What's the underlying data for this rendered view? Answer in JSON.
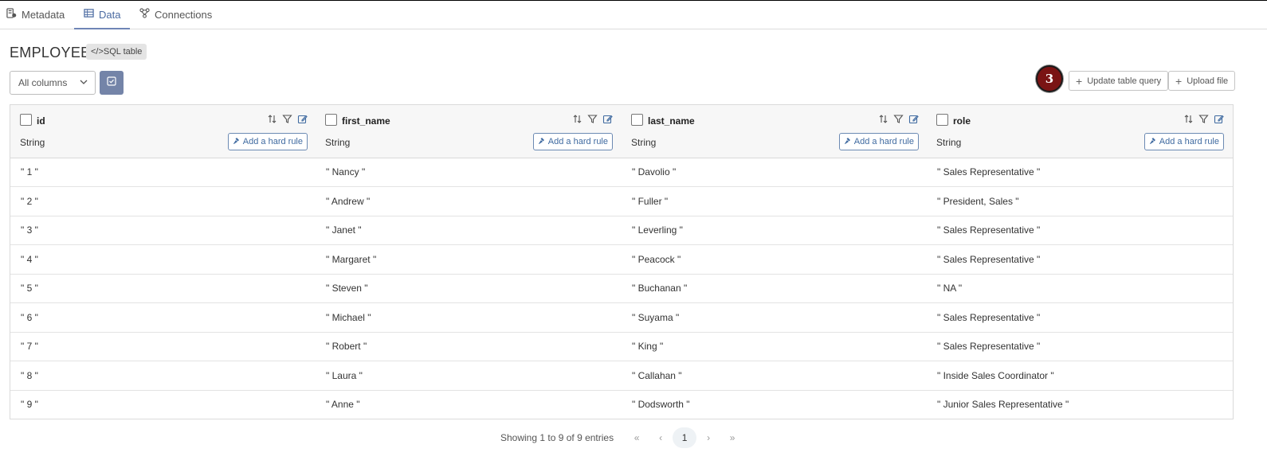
{
  "tabs": [
    {
      "label": "Metadata",
      "icon": "metadata-icon"
    },
    {
      "label": "Data",
      "icon": "table-icon"
    },
    {
      "label": "Connections",
      "icon": "connections-icon"
    }
  ],
  "page": {
    "title": "EMPLOYEE",
    "badge": "</>SQL table"
  },
  "controls": {
    "column_select": "All columns"
  },
  "marker": {
    "label": "3"
  },
  "actions": {
    "update_query": "Update table query",
    "upload_file": "Upload file"
  },
  "table": {
    "columns": [
      {
        "name": "id",
        "type": "String",
        "rule_label": "Add a hard rule"
      },
      {
        "name": "first_name",
        "type": "String",
        "rule_label": "Add a hard rule"
      },
      {
        "name": "last_name",
        "type": "String",
        "rule_label": "Add a hard rule"
      },
      {
        "name": "role",
        "type": "String",
        "rule_label": "Add a hard rule"
      }
    ],
    "rows": [
      [
        "\" 1 \"",
        "\" Nancy \"",
        "\" Davolio \"",
        "\" Sales Representative \""
      ],
      [
        "\" 2 \"",
        "\" Andrew \"",
        "\" Fuller \"",
        "\" President, Sales \""
      ],
      [
        "\" 3 \"",
        "\" Janet \"",
        "\" Leverling \"",
        "\" Sales Representative \""
      ],
      [
        "\" 4 \"",
        "\" Margaret \"",
        "\" Peacock \"",
        "\" Sales Representative \""
      ],
      [
        "\" 5 \"",
        "\" Steven \"",
        "\" Buchanan \"",
        "\" NA \""
      ],
      [
        "\" 6 \"",
        "\" Michael \"",
        "\" Suyama \"",
        "\" Sales Representative \""
      ],
      [
        "\" 7 \"",
        "\" Robert \"",
        "\" King \"",
        "\" Sales Representative \""
      ],
      [
        "\" 8 \"",
        "\" Laura \"",
        "\" Callahan \"",
        "\" Inside Sales Coordinator \""
      ],
      [
        "\" 9 \"",
        "\" Anne \"",
        "\" Dodsworth \"",
        "\" Junior Sales Representative \""
      ]
    ]
  },
  "pagination": {
    "info": "Showing 1 to 9 of 9 entries",
    "current_page": "1",
    "first": "«",
    "prev": "‹",
    "next": "›",
    "last": "»"
  }
}
